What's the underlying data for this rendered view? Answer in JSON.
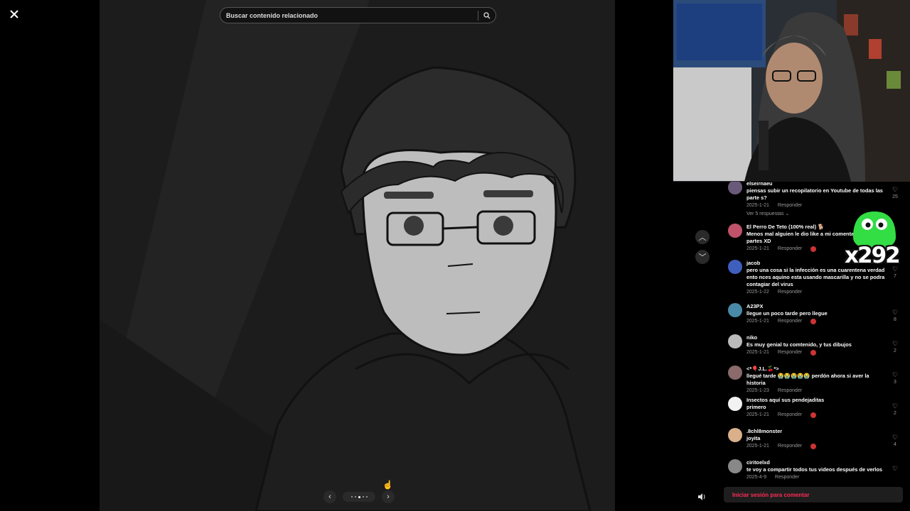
{
  "viewer": {
    "close_icon": "close-icon",
    "search_placeholder": "Buscar contenido relacionado",
    "search_icon": "search-icon",
    "pager_dots": 5,
    "pager_active": 3
  },
  "overlay": {
    "gift_count": "x292"
  },
  "comments": [
    {
      "user": "elseirnaeu",
      "text": "piensas subir un recopilatorio en Youtube de todas las parte s?",
      "date": "2025-1-21",
      "reply": "Responder",
      "likes": "25",
      "replies": "Ver 5 respuestas",
      "creator_liked": false,
      "color": "#6a5a7a"
    },
    {
      "user": "El Perro De Teto (100% real) 🐕",
      "text": "Menos mal alguien le dio like a mi comentario y demás partes XD",
      "date": "2025-1-21",
      "reply": "Responder",
      "likes": "",
      "replies": "",
      "creator_liked": true,
      "color": "#c0536a"
    },
    {
      "user": "jacob",
      "text": "pero una cosa si la infección es una cuarentena verdad ento nces aquino esta usando mascarilla y no se podra contagiar del virus",
      "date": "2025-1-22",
      "reply": "Responder",
      "likes": "7",
      "replies": "",
      "creator_liked": false,
      "color": "#3f5fbf"
    },
    {
      "user": "A23PX",
      "text": "llegue un poco tarde pero llegue",
      "date": "2025-1-21",
      "reply": "Responder",
      "likes": "8",
      "replies": "",
      "creator_liked": true,
      "color": "#4a8aa8"
    },
    {
      "user": "niko",
      "text": "Es muy genial tu comtenido, y tus dibujos",
      "date": "2025-1-21",
      "reply": "Responder",
      "likes": "2",
      "replies": "",
      "creator_liked": true,
      "color": "#bbbbbb"
    },
    {
      "user": "<*🎈J.L.🍒*>",
      "text": "llegué tarde 😭😭😭😭😭 perdón ahora si aver la historia",
      "date": "2025-1-23",
      "reply": "Responder",
      "likes": "3",
      "replies": "",
      "creator_liked": false,
      "color": "#8a6a6a"
    },
    {
      "user": "Insectos aquí sus pendejaditas",
      "text": "primero",
      "date": "2025-1-21",
      "reply": "Responder",
      "likes": "2",
      "replies": "",
      "creator_liked": true,
      "color": "#f2f2f2"
    },
    {
      "user": ".8chl8monster",
      "text": "joyita",
      "date": "2025-1-21",
      "reply": "Responder",
      "likes": "4",
      "replies": "",
      "creator_liked": true,
      "color": "#d9b08a"
    },
    {
      "user": "ciritoelxd",
      "text": "te voy a compartir todos tus videos después de verlos",
      "date": "2025-4-9",
      "reply": "Responder",
      "likes": "",
      "replies": "",
      "creator_liked": false,
      "color": "#888888"
    }
  ],
  "login": {
    "label": "Iniciar sesión para comentar"
  }
}
